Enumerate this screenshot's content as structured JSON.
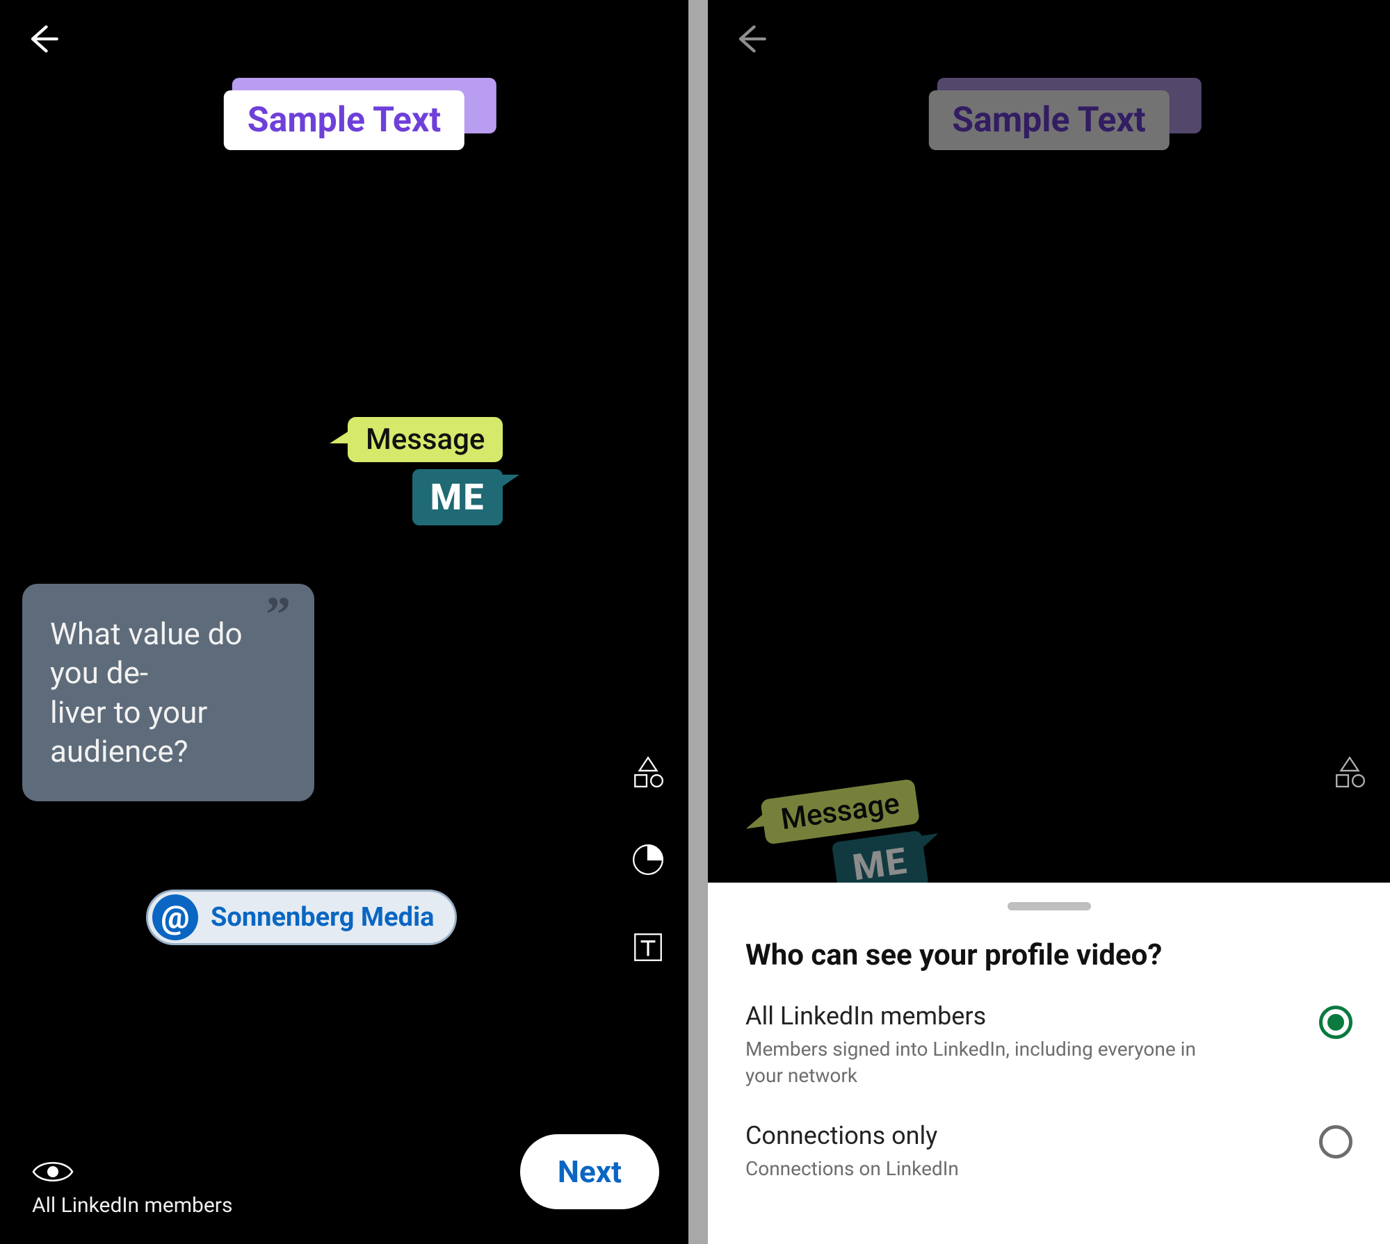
{
  "sticker_sample": "Sample Text",
  "sticker_message": "Message",
  "sticker_me": "ME",
  "quote_text": "What value do you de-\nliver to your audience?",
  "mention_name": "Sonnenberg Media",
  "visibility_label": "All LinkedIn members",
  "next_label": "Next",
  "sheet": {
    "title": "Who can see your profile video?",
    "options": [
      {
        "label": "All LinkedIn members",
        "desc": "Members signed into LinkedIn, including everyone in your network",
        "selected": true
      },
      {
        "label": "Connections only",
        "desc": "Connections on LinkedIn",
        "selected": false
      }
    ]
  }
}
